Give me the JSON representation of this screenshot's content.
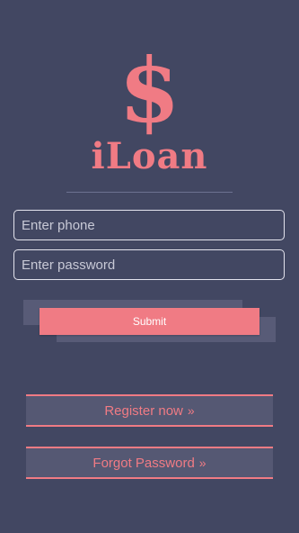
{
  "logo": {
    "symbol": "$",
    "title": "iLoan"
  },
  "form": {
    "phone_placeholder": "Enter phone",
    "password_placeholder": "Enter password",
    "submit_label": "Submit"
  },
  "links": {
    "register_label": "Register now",
    "forgot_label": "Forgot Password",
    "chevron": "»"
  },
  "colors": {
    "background": "#424762",
    "accent": "#f07b84",
    "button_bg": "#555873"
  }
}
